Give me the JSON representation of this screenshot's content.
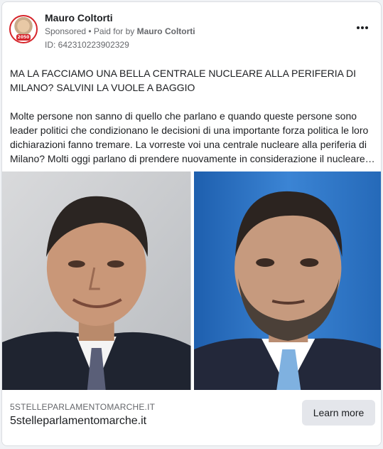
{
  "advertiser": {
    "name": "Mauro Coltorti",
    "sponsored_label": "Sponsored",
    "paid_for_prefix": "• Paid for by",
    "paid_for_name": "Mauro Coltorti",
    "ad_id": "ID: 642310223902329",
    "avatar_badge": "2050"
  },
  "post": {
    "headline": "MA LA FACCIAMO UNA BELLA CENTRALE NUCLEARE ALLA PERIFERIA DI MILANO? SALVINI LA VUOLE A BAGGIO",
    "body": "Molte persone non sanno di quello che parlano e quando queste persone sono leader politici che condizionano le decisioni di una importante forza politica le loro dichiarazioni fanno tremare. La vorreste voi una centrale nucleare alla periferia di Milano? Molti oggi parlano di prendere nuovamente in considerazione il nucleare…"
  },
  "link": {
    "caption": "5STELLEPARLAMENTOMARCHE.IT",
    "title": "5stelleparlamentomarche.it",
    "cta_label": "Learn more"
  },
  "colors": {
    "accent_red": "#d6242a",
    "cta_bg": "#e4e6eb",
    "secondary_text": "#65676b"
  }
}
